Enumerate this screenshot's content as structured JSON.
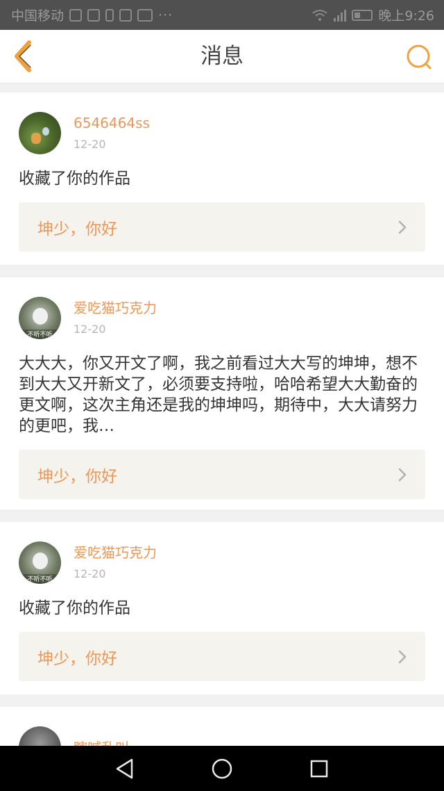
{
  "status_bar": {
    "carrier": "中国移动",
    "time": "晚上9:26",
    "icons": [
      "notification-icon",
      "notification-icon",
      "sim-icon",
      "message-icon",
      "mail-icon",
      "more-dots-icon",
      "wifi-icon",
      "signal-icon",
      "battery-icon"
    ]
  },
  "header": {
    "title": "消息",
    "back_icon": "chevron-left-icon",
    "search_icon": "search-icon",
    "accent_color": "#f0a03c"
  },
  "messages": [
    {
      "username": "6546464ss",
      "date": "12-20",
      "content": "收藏了你的作品",
      "reference": "坤少，你好",
      "avatar": "green-figurine-avatar"
    },
    {
      "username": "爱吃猫巧克力",
      "date": "12-20",
      "content": "大大大，你又开文了啊，我之前看过大大写的坤坤，想不到大大又开新文了，必须要支持啦，哈哈希望大大勤奋的更文啊，这次主角还是我的坤坤吗，期待中，大大请努力的更吧，我…",
      "reference": "坤少，你好",
      "avatar": "cat-avatar",
      "avatar_caption": "不听不听"
    },
    {
      "username": "爱吃猫巧克力",
      "date": "12-20",
      "content": "收藏了你的作品",
      "reference": "坤少，你好",
      "avatar": "cat-avatar",
      "avatar_caption": "不听不听"
    },
    {
      "username": "瞎喊乱叫",
      "date": "",
      "content": "",
      "reference": "",
      "avatar": "gray-avatar"
    }
  ],
  "colors": {
    "username": "#f09656",
    "reference_bg": "#f5f3ed",
    "background": "#f1f1f1"
  },
  "nav_bar": {
    "icons": [
      "back-triangle-icon",
      "home-circle-icon",
      "recents-square-icon"
    ]
  }
}
